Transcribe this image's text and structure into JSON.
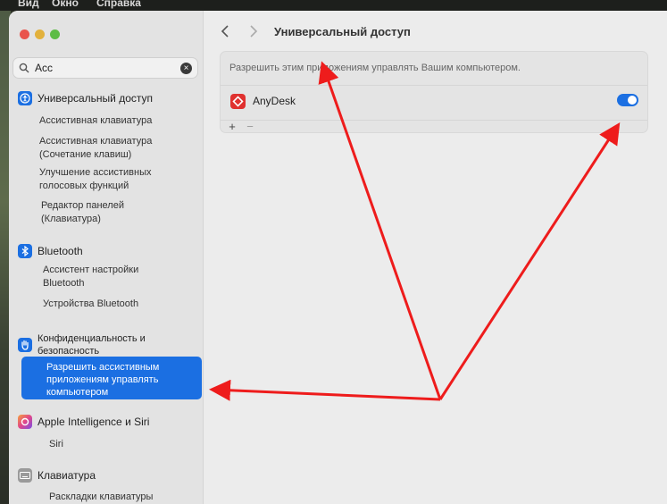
{
  "menubar": {
    "items": [
      "Вид",
      "Окно",
      "Справка"
    ]
  },
  "search": {
    "value": "Acc"
  },
  "sidebar": {
    "sections": [
      {
        "label": "Универсальный доступ",
        "icon": "accessibility-icon",
        "color": "#1b6fe2"
      },
      {
        "label": "Bluetooth",
        "icon": "bluetooth-icon",
        "color": "#1b6fe2"
      },
      {
        "label": "Конфиденциальность и безопасность",
        "icon": "hand-icon",
        "color": "#1b6fe2"
      },
      {
        "label": "Apple Intelligence и Siri",
        "icon": "siri-icon",
        "color": "#e05a8a"
      },
      {
        "label": "Клавиатура",
        "icon": "keyboard-icon",
        "color": "#9a9a9a"
      }
    ],
    "subitems": {
      "accessibility": [
        "Ассистивная клавиатура",
        "Ассистивная клавиатура (Сочетание клавиш)",
        "Улучшение ассистивных голосовых функций",
        "Редактор панелей (Клавиатура)"
      ],
      "bluetooth": [
        "Ассистент настройки Bluetooth",
        "Устройства Bluetooth"
      ],
      "privacy_selected": "Разрешить ассистивным приложениям управлять компьютером",
      "siri": [
        "Siri"
      ],
      "keyboard": [
        "Раскладки клавиатуры"
      ]
    }
  },
  "content": {
    "title": "Универсальный доступ",
    "description": "Разрешить этим приложениям управлять Вашим компьютером.",
    "apps": [
      {
        "name": "AnyDesk",
        "enabled": true
      }
    ],
    "add_label": "+",
    "remove_label": "−"
  },
  "colors": {
    "accent": "#1b6fe2",
    "arrow": "#ee1c1c"
  }
}
